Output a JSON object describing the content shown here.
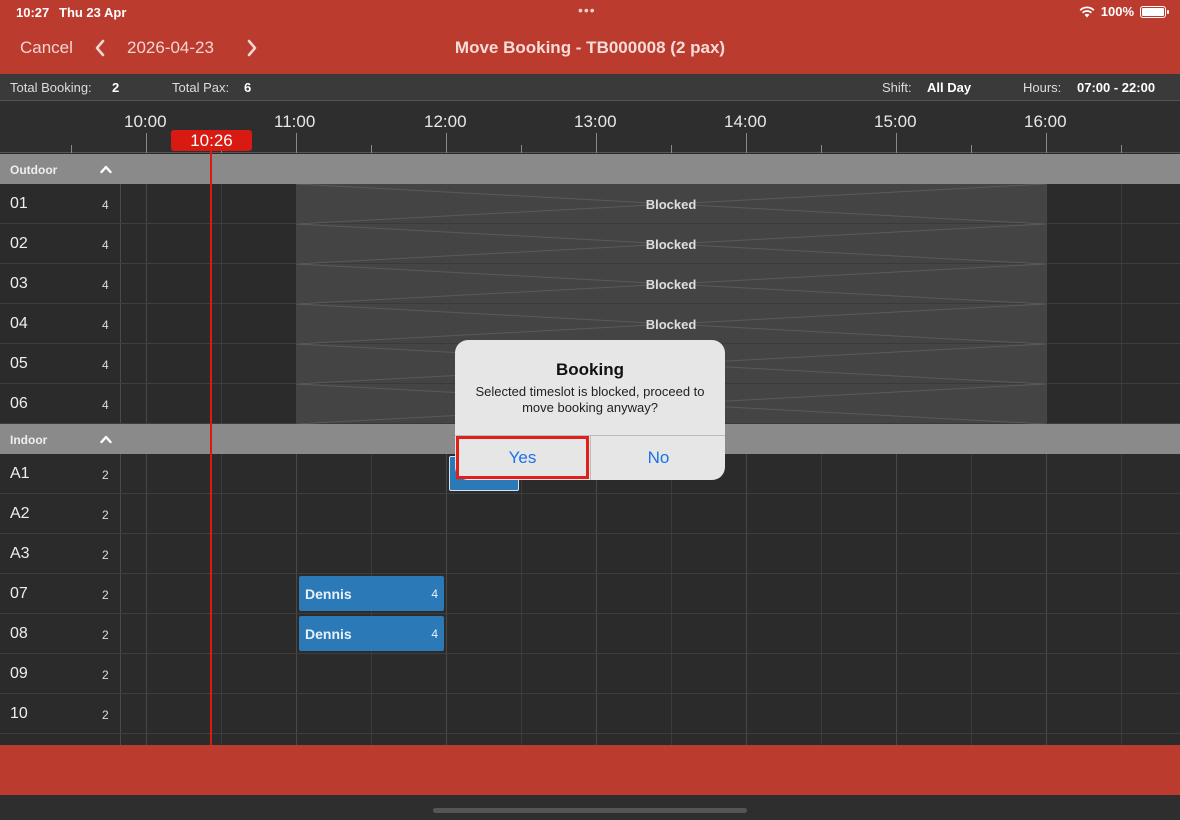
{
  "status": {
    "time": "10:27",
    "date": "Thu 23 Apr",
    "dots": "•••",
    "battery": "100%"
  },
  "nav": {
    "cancel": "Cancel",
    "date": "2026-04-23",
    "title": "Move Booking - TB000008 (2 pax)"
  },
  "summary": {
    "total_booking_label": "Total Booking:",
    "total_booking": "2",
    "total_pax_label": "Total Pax:",
    "total_pax": "6",
    "shift_label": "Shift:",
    "shift": "All Day",
    "hours_label": "Hours:",
    "hours": "07:00 - 22:00"
  },
  "timeline": {
    "hours": [
      "10:00",
      "11:00",
      "12:00",
      "13:00",
      "14:00",
      "15:00",
      "16:00"
    ],
    "now": "10:26"
  },
  "sections": [
    {
      "name": "Outdoor",
      "rows": [
        {
          "name": "01",
          "cap": "4",
          "blocked": "Blocked"
        },
        {
          "name": "02",
          "cap": "4",
          "blocked": "Blocked"
        },
        {
          "name": "03",
          "cap": "4",
          "blocked": "Blocked"
        },
        {
          "name": "04",
          "cap": "4",
          "blocked": "Blocked"
        },
        {
          "name": "05",
          "cap": "4",
          "blocked": ""
        },
        {
          "name": "06",
          "cap": "4",
          "blocked": ""
        }
      ]
    },
    {
      "name": "Indoor",
      "rows": [
        {
          "name": "A1",
          "cap": "2"
        },
        {
          "name": "A2",
          "cap": "2"
        },
        {
          "name": "A3",
          "cap": "2"
        },
        {
          "name": "07",
          "cap": "2",
          "booking": {
            "name": "Dennis",
            "pax": "4"
          }
        },
        {
          "name": "08",
          "cap": "2",
          "booking": {
            "name": "Dennis",
            "pax": "4"
          }
        },
        {
          "name": "09",
          "cap": "2"
        },
        {
          "name": "10",
          "cap": "2"
        }
      ]
    }
  ],
  "colors": {
    "accent": "#bb3b2f",
    "booking": "#2c79b7",
    "now": "#d81a12"
  },
  "dialog": {
    "title": "Booking",
    "message": "Selected timeslot is blocked, proceed to move booking anyway?",
    "yes": "Yes",
    "no": "No"
  }
}
